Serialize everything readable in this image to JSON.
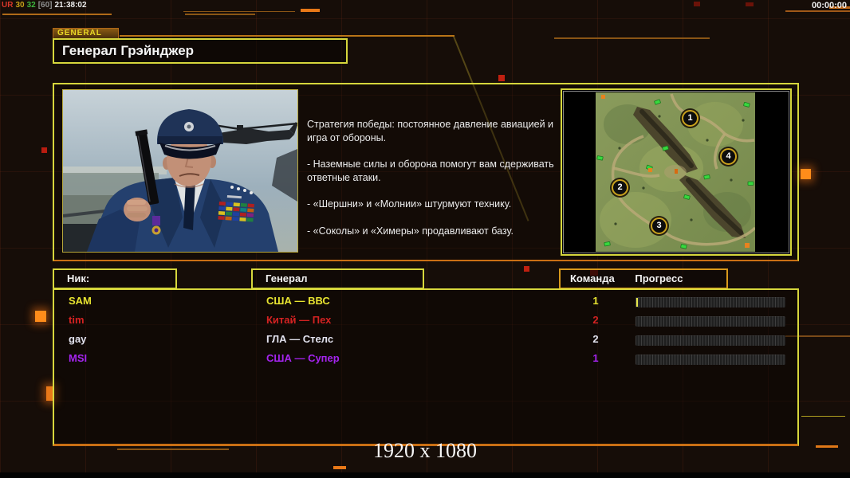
{
  "hud": {
    "debug": {
      "tag": "UR",
      "val1": "30",
      "val2": "32",
      "val3": "[60]",
      "clock": "21:38:02"
    },
    "match_timer": "00:00:00",
    "resolution_label": "1920 x 1080"
  },
  "panel": {
    "tab_label": "GENERAL",
    "title": "Генерал Грэйнджер",
    "strategy": [
      "Стратегия победы: постоянное давление авиацией и игра от обороны.",
      "- Наземные силы и оборона помогут вам сдерживать ответные атаки.",
      "- «Шершни» и «Молнии» штурмуют технику.",
      "- «Соколы» и «Химеры» продавливают базу."
    ]
  },
  "map": {
    "markers": [
      {
        "label": "1"
      },
      {
        "label": "2"
      },
      {
        "label": "3"
      },
      {
        "label": "4"
      }
    ]
  },
  "lobby": {
    "headers": {
      "nick": "Ник:",
      "general": "Генерал",
      "team": "Команда",
      "progress": "Прогресс"
    },
    "players": [
      {
        "name": "SAM",
        "general": "США — ВВС",
        "team": "1",
        "color": "#e8e431"
      },
      {
        "name": "tim",
        "general": "Китай — Пех",
        "team": "2",
        "color": "#d42222"
      },
      {
        "name": "gay",
        "general": "ГЛА — Стелс",
        "team": "2",
        "color": "#e2e2ee"
      },
      {
        "name": "MSI",
        "general": "США — Супер",
        "team": "1",
        "color": "#a524ef"
      }
    ]
  },
  "colors": {
    "accent_yellow": "#d6d63c",
    "accent_orange": "#e07818",
    "border_orange": "#c96f14",
    "cursor_yellow": "#e6e64a"
  }
}
